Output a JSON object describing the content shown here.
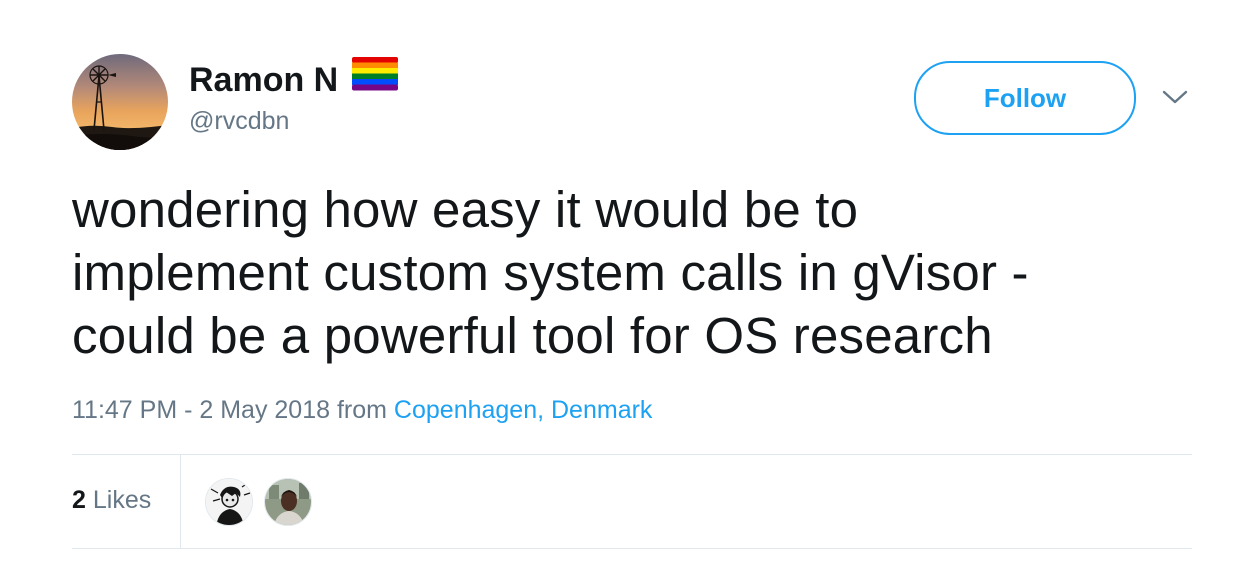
{
  "user": {
    "display_name": "Ramon N",
    "handle": "@rvcdbn",
    "avatar_icon": "windmill-sunset-avatar",
    "flag_icon": "rainbow-flag-icon"
  },
  "actions": {
    "follow_label": "Follow",
    "more_icon": "chevron-down-icon"
  },
  "tweet": {
    "lines": [
      "wondering how easy it would be to",
      "implement custom system calls in gVisor -",
      "could be a powerful tool for OS research"
    ],
    "timestamp": "11:47 PM - 2 May 2018",
    "from_label": "from",
    "location": "Copenhagen, Denmark"
  },
  "stats": {
    "likes_count": "2",
    "likes_label": "Likes",
    "likers": [
      "liker-avatar-1",
      "liker-avatar-2"
    ]
  },
  "colors": {
    "accent": "#1da1f2",
    "text": "#14171a",
    "muted": "#657786",
    "border": "#e1e8ed"
  }
}
